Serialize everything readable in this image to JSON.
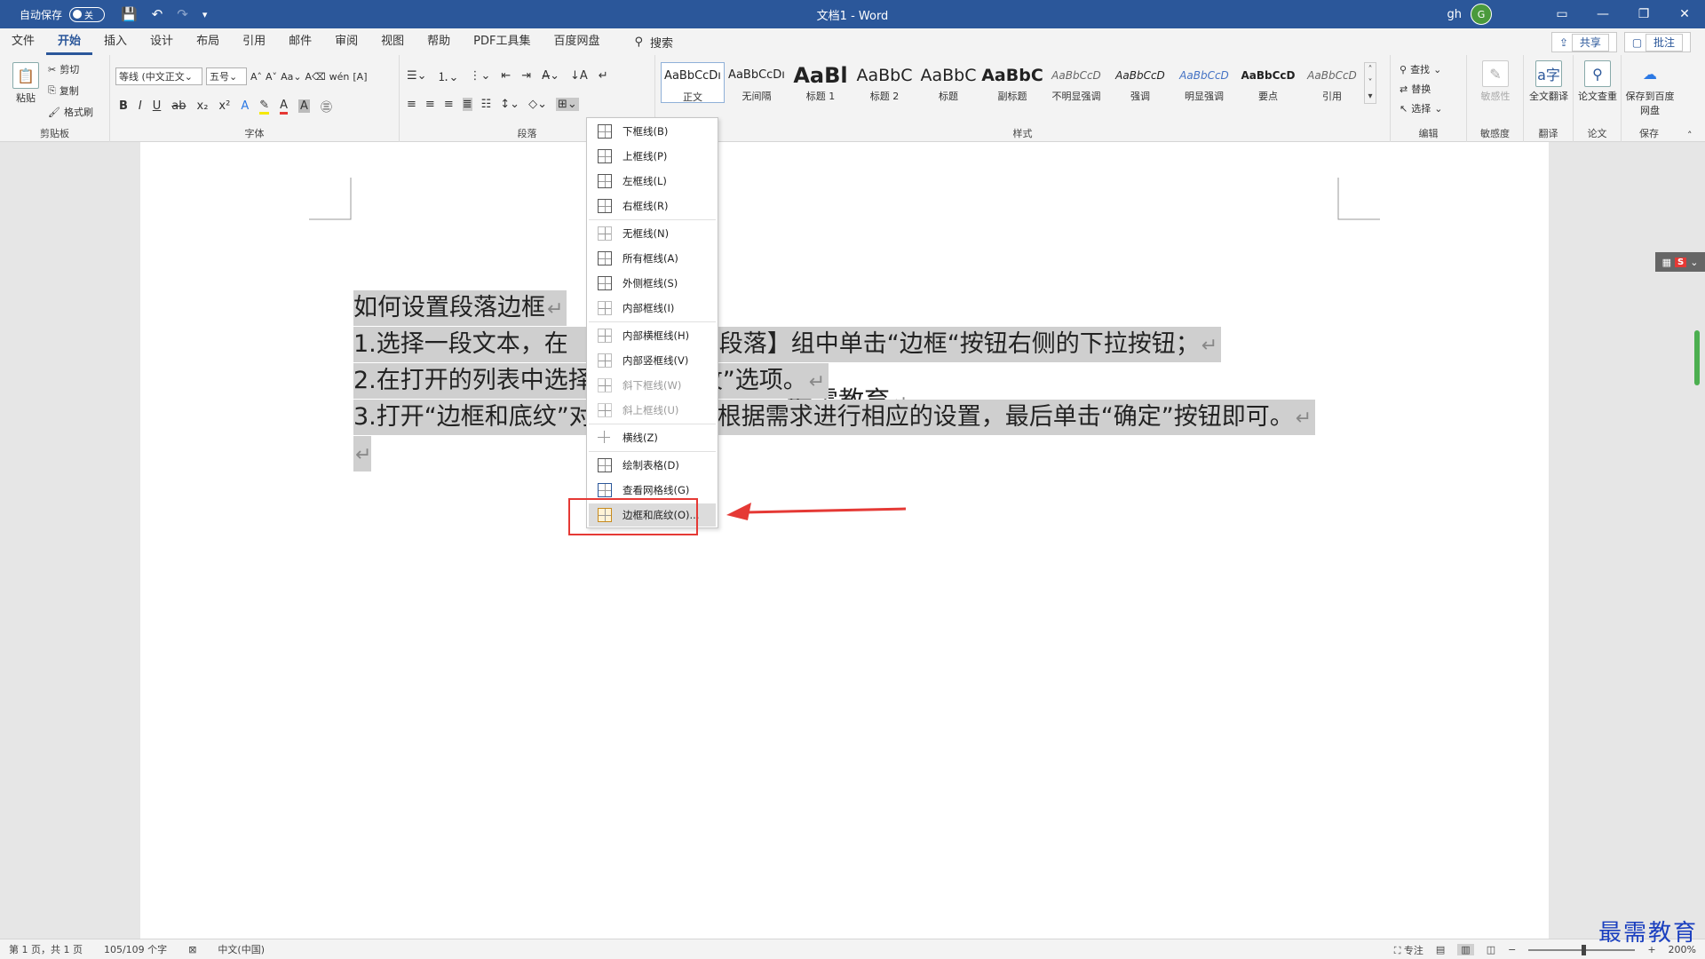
{
  "titlebar": {
    "autosave_label": "自动保存",
    "autosave_state": "关",
    "doc_title": "文档1 - Word",
    "user_name": "gh",
    "avatar_initial": "G"
  },
  "tabs": [
    "文件",
    "开始",
    "插入",
    "设计",
    "布局",
    "引用",
    "邮件",
    "审阅",
    "视图",
    "帮助",
    "PDF工具集",
    "百度网盘"
  ],
  "active_tab": "开始",
  "search_label": "搜索",
  "share_label": "共享",
  "comment_label": "批注",
  "ribbon": {
    "clipboard": {
      "paste": "粘贴",
      "cut": "剪切",
      "copy": "复制",
      "format_painter": "格式刷",
      "group": "剪贴板"
    },
    "font": {
      "font_name": "等线 (中文正文",
      "font_size": "五号",
      "group": "字体"
    },
    "paragraph": {
      "group": "段落"
    },
    "styles": {
      "group": "样式",
      "items": [
        {
          "preview": "AaBbCcDı",
          "name": "正文"
        },
        {
          "preview": "AaBbCcDı",
          "name": "无间隔"
        },
        {
          "preview": "AaBl",
          "name": "标题 1"
        },
        {
          "preview": "AaBbC",
          "name": "标题 2"
        },
        {
          "preview": "AaBbC",
          "name": "标题"
        },
        {
          "preview": "AaBbC",
          "name": "副标题"
        },
        {
          "preview": "AaBbCcD",
          "name": "不明显强调"
        },
        {
          "preview": "AaBbCcD",
          "name": "强调"
        },
        {
          "preview": "AaBbCcD",
          "name": "明显强调"
        },
        {
          "preview": "AaBbCcD",
          "name": "要点"
        },
        {
          "preview": "AaBbCcD",
          "name": "引用"
        }
      ]
    },
    "editing": {
      "find": "查找",
      "replace": "替换",
      "select": "选择",
      "group": "编辑"
    },
    "sensitivity": {
      "label": "敏感性",
      "group": "敏感度"
    },
    "translate": {
      "label": "全文翻译",
      "group": "翻译"
    },
    "paper": {
      "label": "论文查重",
      "group": "论文"
    },
    "save": {
      "label": "保存到百度网盘",
      "group": "保存"
    }
  },
  "border_menu": [
    {
      "label": "下框线(B)",
      "disabled": false
    },
    {
      "label": "上框线(P)",
      "disabled": false
    },
    {
      "label": "左框线(L)",
      "disabled": false
    },
    {
      "label": "右框线(R)",
      "disabled": false
    },
    {
      "label": "无框线(N)",
      "disabled": false
    },
    {
      "label": "所有框线(A)",
      "disabled": false
    },
    {
      "label": "外侧框线(S)",
      "disabled": false
    },
    {
      "label": "内部框线(I)",
      "disabled": false
    },
    {
      "label": "内部横框线(H)",
      "disabled": false
    },
    {
      "label": "内部竖框线(V)",
      "disabled": false
    },
    {
      "label": "斜下框线(W)",
      "disabled": true
    },
    {
      "label": "斜上框线(U)",
      "disabled": true
    },
    {
      "label": "横线(Z)",
      "disabled": false
    },
    {
      "label": "绘制表格(D)",
      "disabled": false
    },
    {
      "label": "查看网格线(G)",
      "disabled": false
    },
    {
      "label": "边框和底纹(O)...",
      "disabled": false
    }
  ],
  "document": {
    "heading": "最需教育",
    "lines": [
      "如何设置段落边框",
      "1.选择一段文本，在",
      "段落】组中单击“边框“按钮右侧的下拉按钮；",
      "2.在打开的列表中选择",
      "纹”选项。",
      "3.打开“边框和底纹”对",
      "根据需求进行相应的设置，最后单击“确定”按钮即可。"
    ]
  },
  "status": {
    "page": "第 1 页，共 1 页",
    "words": "105/109 个字",
    "language": "中文(中国)",
    "focus": "专注",
    "zoom": "200%"
  },
  "watermark": "最需教育",
  "colors": {
    "brand": "#2b579a",
    "highlight": "#e53935",
    "selection": "#cfcfcf"
  }
}
